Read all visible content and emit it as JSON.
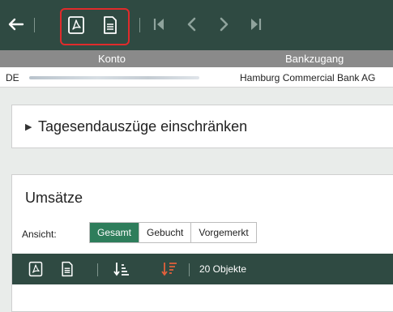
{
  "toolbar": {
    "icons": [
      "back-arrow-icon",
      "pdf-icon",
      "document-icon",
      "first-page-icon",
      "previous-page-icon",
      "next-page-icon",
      "last-page-icon"
    ]
  },
  "table": {
    "headers": [
      "Konto",
      "Bankzugang"
    ],
    "row": {
      "account": "DE",
      "bank": "Hamburg Commercial Bank AG"
    }
  },
  "filter_panel": {
    "label": "Tagesendauszüge einschränken"
  },
  "transactions": {
    "title": "Umsätze",
    "view_label": "Ansicht:",
    "views": [
      "Gesamt",
      "Gebucht",
      "Vorgemerkt"
    ],
    "active_view": "Gesamt",
    "count_label": "20 Objekte"
  },
  "colors": {
    "toolbar": "#2f4a42",
    "accent": "#2e7d5b",
    "highlight": "#e02b2b",
    "sort_desc": "#e2603c"
  }
}
